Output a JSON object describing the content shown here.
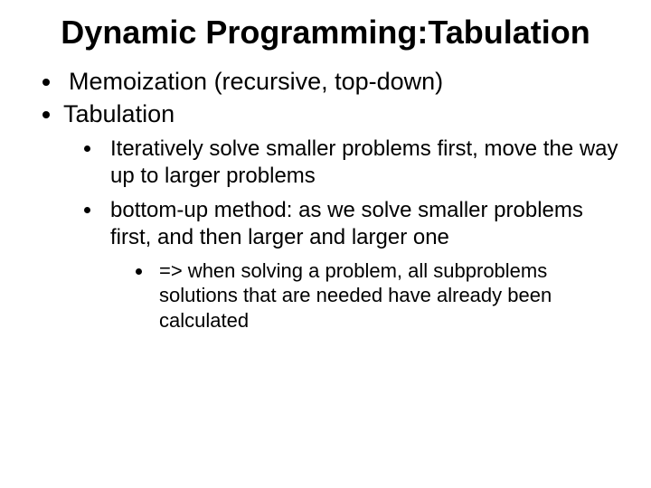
{
  "title": "Dynamic Programming:Tabulation",
  "bullets": {
    "item1": "Memoization (recursive, top-down)",
    "item2": "Tabulation",
    "sub1": "Iteratively solve smaller problems first, move the way up to larger problems",
    "sub2": "bottom-up method: as we solve smaller problems first, and then larger and larger one",
    "subsub1": "=> when solving a problem, all subproblems solutions that are needed have already been calculated"
  }
}
